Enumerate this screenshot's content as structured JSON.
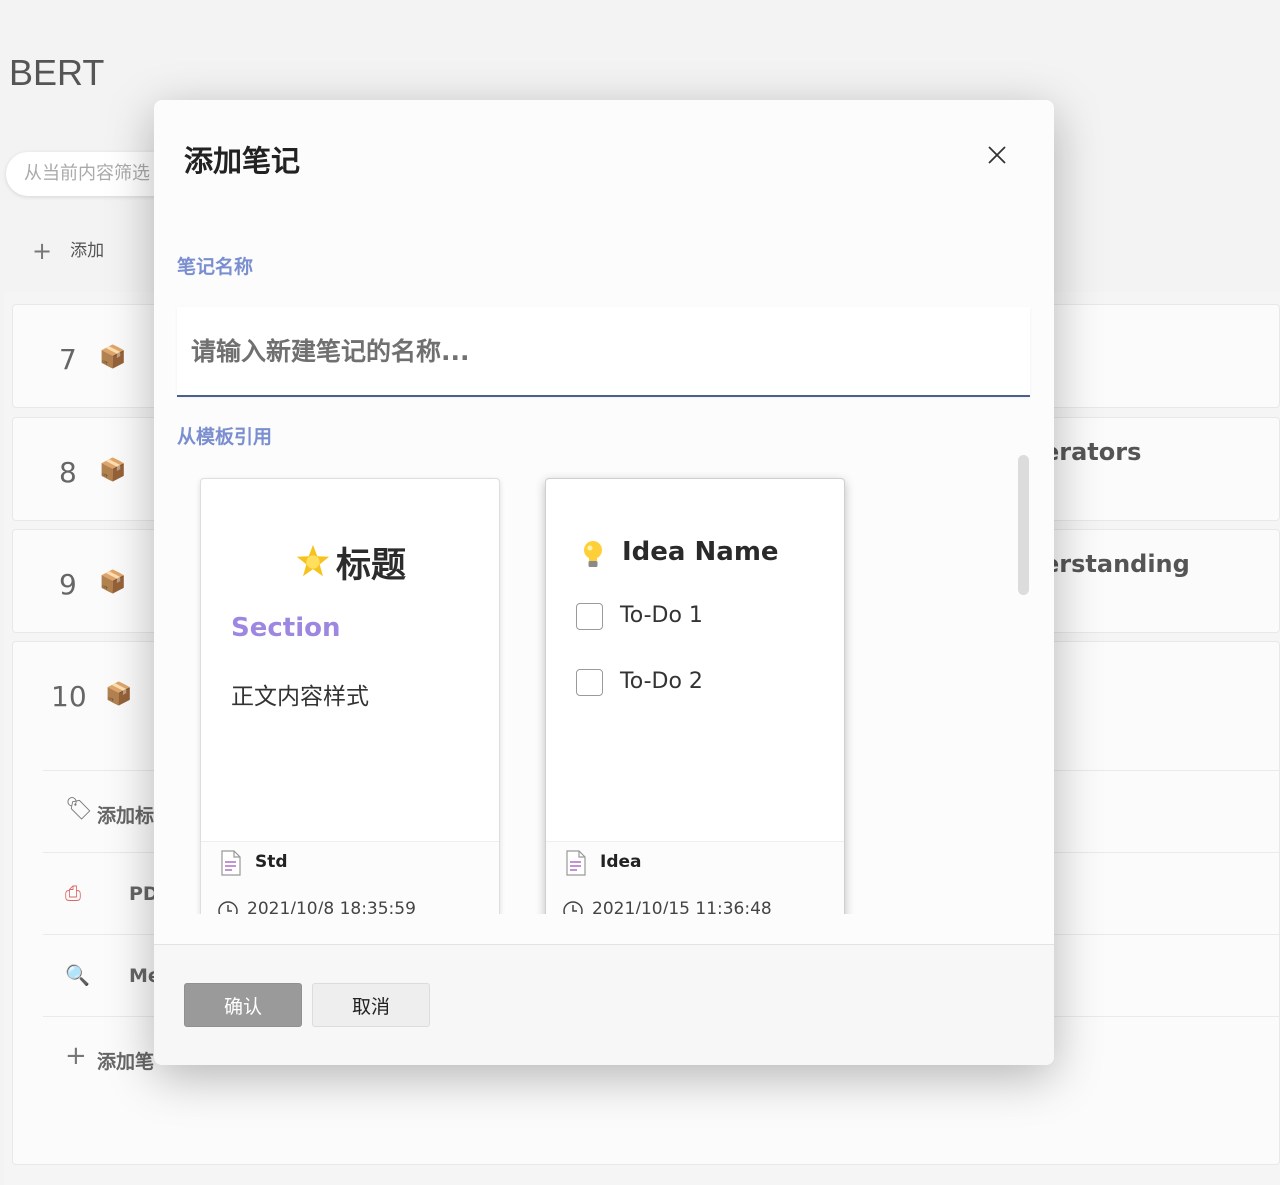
{
  "background": {
    "title": "BERT",
    "filter_placeholder": "从当前内容筛选",
    "add_label": "添加",
    "rows": [
      {
        "num": "7",
        "text": ""
      },
      {
        "num": "8",
        "text": "erators"
      },
      {
        "num": "9",
        "text": "erstanding"
      },
      {
        "num": "10",
        "text": ""
      }
    ],
    "sub_items": [
      {
        "label": "添加标"
      },
      {
        "label": "PD"
      },
      {
        "label": "Me"
      },
      {
        "label": "添加笔"
      }
    ]
  },
  "dialog": {
    "title": "添加笔记",
    "name_label": "笔记名称",
    "name_placeholder": "请输入新建笔记的名称...",
    "template_label": "从模板引用",
    "templates": [
      {
        "heading": "标题",
        "section": "Section",
        "body": "正文内容样式",
        "name": "Std",
        "time": "2021/10/8 18:35:59"
      },
      {
        "heading": "Idea Name",
        "todos": [
          "To-Do 1",
          "To-Do 2"
        ],
        "name": "Idea",
        "time": "2021/10/15 11:36:48"
      }
    ],
    "confirm_label": "确认",
    "cancel_label": "取消"
  }
}
